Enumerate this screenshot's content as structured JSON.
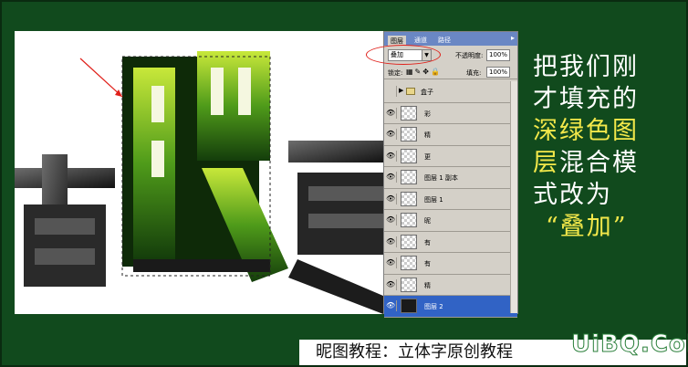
{
  "panel": {
    "tabs": [
      "图层",
      "通道",
      "路径"
    ],
    "blend_mode": "叠加",
    "opacity_label": "不透明度:",
    "opacity_value": "100%",
    "lock_label": "锁定:",
    "fill_label": "填充:",
    "fill_value": "100%",
    "layers": [
      {
        "name": "盒子",
        "type": "group"
      },
      {
        "name": "彩",
        "type": "layer"
      },
      {
        "name": "精",
        "type": "layer"
      },
      {
        "name": "更",
        "type": "layer"
      },
      {
        "name": "图层 1 副本",
        "type": "layer"
      },
      {
        "name": "图层 1",
        "type": "layer"
      },
      {
        "name": "昵",
        "type": "layer"
      },
      {
        "name": "有",
        "type": "layer"
      },
      {
        "name": "有",
        "type": "layer"
      },
      {
        "name": "精",
        "type": "layer"
      },
      {
        "name": "图层 2",
        "type": "layer",
        "selected": true
      }
    ]
  },
  "description": {
    "line1": "把我们刚",
    "line2": "才填充的",
    "line3_hl": "深绿色图",
    "line4_hl": "层",
    "line4_rest": "混合模",
    "line5": "式改为",
    "line6_hl": "“叠加”"
  },
  "caption": "昵图教程：立体字原创教程",
  "watermark": "UiBQ.CoM",
  "colors": {
    "background": "#114a1d",
    "highlight": "#f3e84a",
    "selected_layer": "#3163c5"
  }
}
